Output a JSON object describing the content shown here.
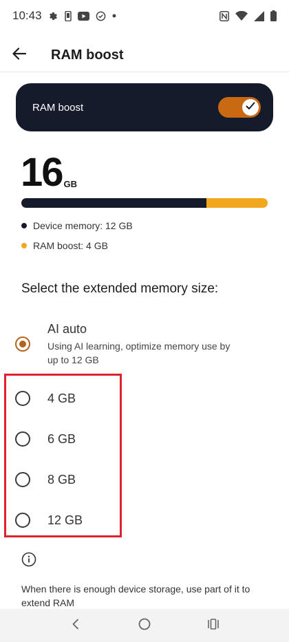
{
  "status_bar": {
    "time": "10:43",
    "left_icons": [
      "gear-icon",
      "phone-icon",
      "youtube-icon",
      "sync-icon",
      "dot-icon"
    ],
    "right_icons": [
      "nfc-icon",
      "wifi-icon",
      "signal-icon",
      "battery-icon"
    ]
  },
  "app_bar": {
    "title": "RAM boost",
    "back_icon": "arrow-left-icon"
  },
  "boost_card": {
    "label": "RAM boost",
    "toggle_on": true,
    "toggle_color": "#c96a12"
  },
  "memory": {
    "total_value": "16",
    "total_unit": "GB",
    "device_fraction": 0.75,
    "device_color": "#161b2b",
    "boost_color": "#f2a81e",
    "legend": [
      {
        "label": "Device memory: 12 GB"
      },
      {
        "label": "RAM boost: 4 GB"
      }
    ]
  },
  "section_title": "Select the extended memory size:",
  "options": [
    {
      "title": "AI auto",
      "desc": "Using AI learning, optimize memory use by up to 12 GB",
      "selected": true
    },
    {
      "title": "4 GB",
      "selected": false
    },
    {
      "title": "6 GB",
      "selected": false
    },
    {
      "title": "8 GB",
      "selected": false
    },
    {
      "title": "12 GB",
      "selected": false
    }
  ],
  "info": {
    "icon": "info-icon",
    "text": "When there is enough device storage, use part of it to extend RAM"
  },
  "nav_bar": {
    "icons": [
      "back-chevron-icon",
      "home-circle-icon",
      "recents-icon"
    ]
  },
  "accent_color": "#b4631a",
  "highlight_color": "#e0202e"
}
